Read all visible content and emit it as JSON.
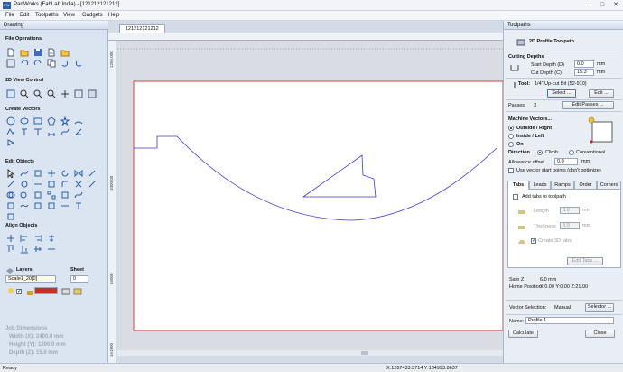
{
  "window": {
    "title": "PartWorks (FabLab India) - [121212121212]",
    "minimize": "–",
    "maximize": "□",
    "close": "✕",
    "app_icon": "PW"
  },
  "menu": [
    "File",
    "Edit",
    "Toolpaths",
    "View",
    "Gadgets",
    "Help"
  ],
  "left": {
    "header": "Drawing",
    "sections": {
      "file_ops": "File Operations",
      "view_control": "2D View Control",
      "create_vectors": "Create Vectors",
      "edit_objects": "Edit Objects",
      "align_objects": "Align Objects"
    },
    "layers_label": "Layers",
    "sheet_label": "Sheet",
    "layer_value": "Scale1_20[0]",
    "sheet_value": "0",
    "job_title": "Job Dimensions",
    "job_lines": [
      "Width  (X): 2400.0 mm",
      "Height (Y): 1200.0 mm",
      "Depth  (Z): 15.0 mm"
    ]
  },
  "doc": {
    "tab": "121212121212",
    "ruler_left": [
      "1250.000",
      "1000.00",
      "1e000",
      "1e1000"
    ]
  },
  "right": {
    "header": "Toolpaths",
    "tp_title": "2D Profile Toolpath",
    "cutting_depths": "Cutting Depths",
    "start_depth_label": "Start Depth (D)",
    "start_depth": "0.0",
    "cut_depth_label": "Cut Depth (C)",
    "cut_depth": "15.3",
    "unit": "mm",
    "tool_label": "Tool:",
    "tool_name": "1/4\" Up-cut Bit (52-910)",
    "select_btn": "Select ...",
    "edit_btn": "Edit ...",
    "passes_label": "Passes:",
    "passes": "3",
    "edit_passes_btn": "Edit Passes ...",
    "machine_vectors": "Machine Vectors...",
    "outside": "Outside / Right",
    "inside": "Inside / Left",
    "on": "On",
    "direction": "Direction",
    "climb": "Climb",
    "conventional": "Conventional",
    "allowance_label": "Allowance offset",
    "allowance": "0.0",
    "allowance_unit": "mm",
    "vector_start": "Use vector start points (don't optimize)",
    "tabs": [
      "Tabs",
      "Leads",
      "Ramps",
      "Order",
      "Corners"
    ],
    "add_tabs": "Add tabs to toolpath",
    "length_label": "Length",
    "length": "8.0",
    "thickness_label": "Thickness",
    "thickness": "8.0",
    "create_3d": "Create 3D tabs",
    "edit_tabs_btn": "Edit Tabs ...",
    "safe_z_label": "Safe Z",
    "safe_z": "6.0 mm",
    "home_label": "Home Position",
    "home": "X:0.00 Y:0.00 Z:21.00",
    "vector_sel_label": "Vector Selection:",
    "vector_sel": "Manual",
    "selector_btn": "Selector ...",
    "name_label": "Name:",
    "name": "Profile 1",
    "calculate_btn": "Calculate",
    "close_btn": "Close"
  },
  "status": {
    "left": "Ready",
    "coords": "X:1287433.3714 Y:134993.8637"
  },
  "colors": {
    "accent": "#2b5fa8",
    "vector": "#3a3ad0",
    "board_border": "#d01a1a"
  }
}
